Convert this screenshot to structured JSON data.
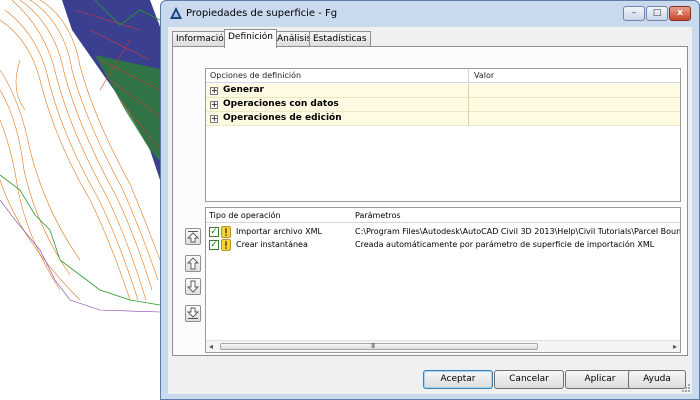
{
  "window": {
    "title": "Propiedades de superficie - Fg",
    "caption_buttons": {
      "minimize": "–",
      "maximize": "□",
      "close": "x"
    }
  },
  "tabs": [
    {
      "label": "Información",
      "active": false
    },
    {
      "label": "Definición",
      "active": true
    },
    {
      "label": "Análisis",
      "active": false
    },
    {
      "label": "Estadísticas",
      "active": false
    }
  ],
  "definition_grid": {
    "columns": [
      "Opciones de definición",
      "Valor"
    ],
    "rows": [
      {
        "expander": "+",
        "label": "Generar"
      },
      {
        "expander": "+",
        "label": "Operaciones con datos"
      },
      {
        "expander": "+",
        "label": "Operaciones de edición"
      }
    ]
  },
  "operations": {
    "columns": [
      "Tipo de operación",
      "Parámetros"
    ],
    "rows": [
      {
        "checked": true,
        "checkmark": "✓",
        "warning_icon": "warning-icon",
        "type": "Importar archivo XML",
        "parameters": "C:\\Program Files\\Autodesk\\AutoCAD Civil 3D 2013\\Help\\Civil Tutorials\\Parcel Boundary"
      },
      {
        "checked": true,
        "checkmark": "✓",
        "warning_icon": "warning-icon",
        "type": "Crear instantánea",
        "parameters": "Creada automáticamente por parámetro de superficie de importación XML"
      }
    ],
    "scroll": {
      "left": "◂",
      "right": "▸",
      "grip": "III"
    }
  },
  "side_buttons": [
    "move-to-top-icon",
    "move-up-icon",
    "move-down-icon",
    "move-to-bottom-icon"
  ],
  "buttons": {
    "accept": "Aceptar",
    "cancel": "Cancelar",
    "apply": "Aplicar",
    "help": "Ayuda"
  },
  "colors": {
    "window_frame": "#c9d9ee",
    "grid_row_bg": "#fffbe3",
    "cad_dark_fill": "#3a3f8f",
    "cad_green": "#2e9a2a",
    "cad_orange": "#e07a20"
  }
}
